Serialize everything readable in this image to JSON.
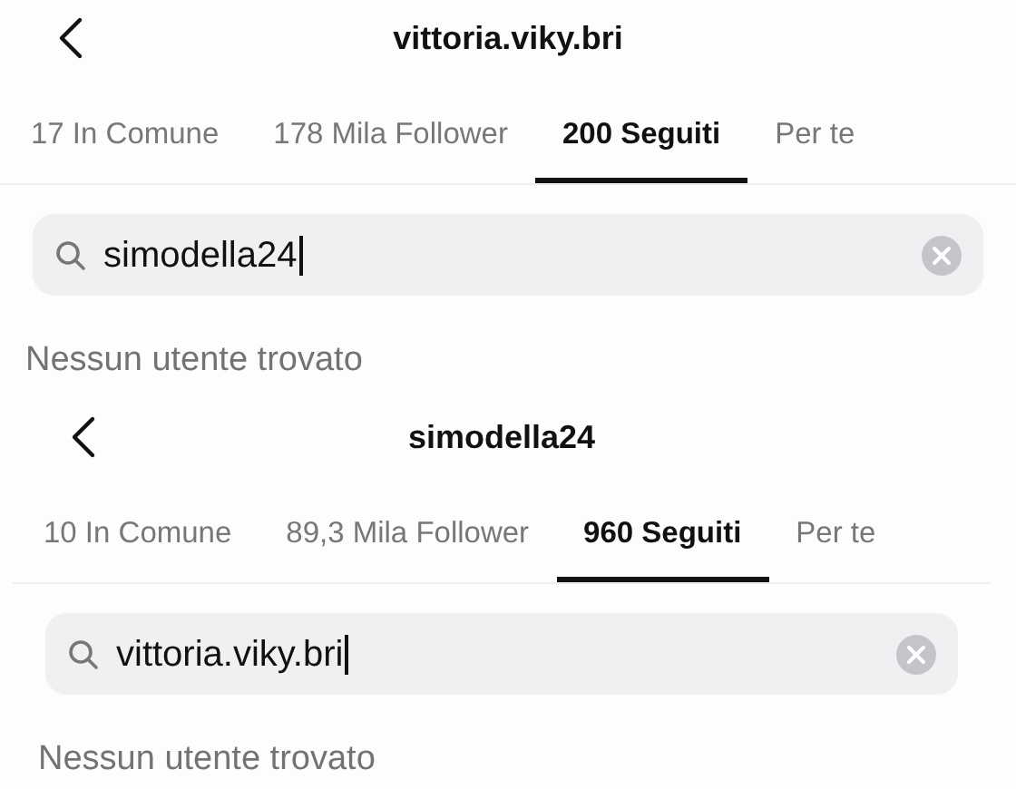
{
  "screens": [
    {
      "title": "vittoria.viky.bri",
      "tabs": [
        {
          "label": "17 In Comune",
          "selected": false
        },
        {
          "label": "178 Mila Follower",
          "selected": false
        },
        {
          "label": "200 Seguiti",
          "selected": true
        },
        {
          "label": "Per te",
          "selected": false
        }
      ],
      "search": {
        "value": "simodella24"
      },
      "message": "Nessun utente trovato"
    },
    {
      "title": "simodella24",
      "tabs": [
        {
          "label": "10 In Comune",
          "selected": false
        },
        {
          "label": "89,3 Mila Follower",
          "selected": false
        },
        {
          "label": "960 Seguiti",
          "selected": true
        },
        {
          "label": "Per te",
          "selected": false
        }
      ],
      "search": {
        "value": "vittoria.viky.bri"
      },
      "message": "Nessun utente trovato"
    }
  ]
}
